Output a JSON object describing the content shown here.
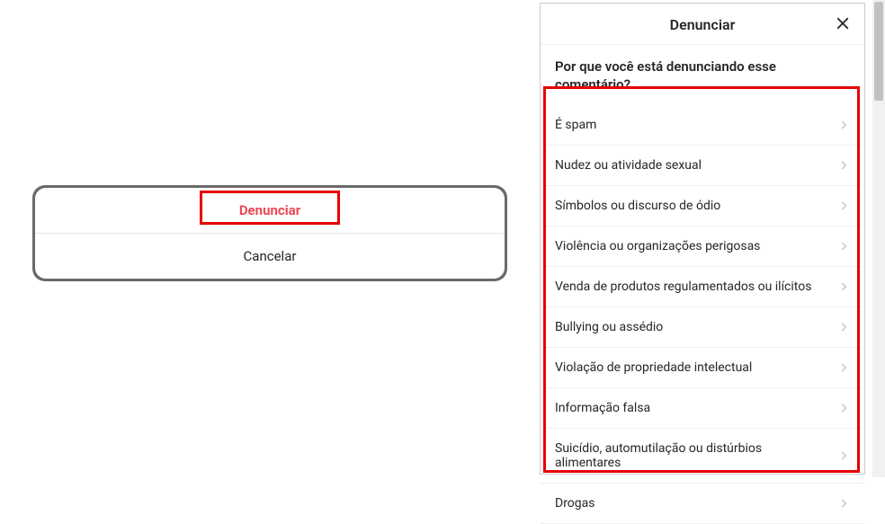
{
  "dialog": {
    "report_label": "Denunciar",
    "cancel_label": "Cancelar"
  },
  "modal": {
    "title": "Denunciar",
    "prompt": "Por que você está denunciando esse comentário?",
    "options": [
      "É spam",
      "Nudez ou atividade sexual",
      "Símbolos ou discurso de ódio",
      "Violência ou organizações perigosas",
      "Venda de produtos regulamentados ou ilícitos",
      "Bullying ou assédio",
      "Violação de propriedade intelectual",
      "Informação falsa",
      "Suicídio, automutilação ou distúrbios alimentares",
      "Drogas"
    ]
  }
}
